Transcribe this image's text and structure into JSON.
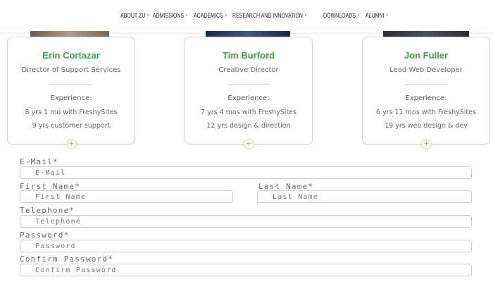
{
  "nav": {
    "items": [
      {
        "label": "ABOUT ZU",
        "chevron": "˅"
      },
      {
        "label": "ADMISSIONS",
        "chevron": "˅"
      },
      {
        "label": "ACADEMICS",
        "chevron": "˅"
      },
      {
        "label": "RESEARCH AND INNOVATION",
        "chevron": "˅"
      },
      {
        "label": "DOWNLOADS",
        "chevron": "˅"
      },
      {
        "label": "ALUMNI",
        "chevron": "˅"
      }
    ]
  },
  "team": [
    {
      "name": "Erin Cortazar",
      "role": "Director of Support Services",
      "exp_label": "Experience:",
      "exp1": "8 yrs 1 mo with FreshySites",
      "exp2": "9 yrs customer support",
      "plus": "+"
    },
    {
      "name": "Tim Burford",
      "role": "Creative Director",
      "exp_label": "Experience:",
      "exp1": "7 yrs 4 mos with FreshySites",
      "exp2": "12 yrs design & direction",
      "plus": "+"
    },
    {
      "name": "Jon Fuller",
      "role": "Lead Web Developer",
      "exp_label": "Experience:",
      "exp1": "6 yrs 11 mos with FreshySites",
      "exp2": "19 yrs web design & dev",
      "plus": "+"
    }
  ],
  "form": {
    "email": {
      "label": "E-Mail*",
      "placeholder": "E-Mail"
    },
    "first_name": {
      "label": "First Name*",
      "placeholder": "First Name"
    },
    "last_name": {
      "label": "Last Name*",
      "placeholder": "Last Name"
    },
    "telephone": {
      "label": "Telephone*",
      "placeholder": "Telephone"
    },
    "password": {
      "label": "Password*",
      "placeholder": "Password"
    },
    "confirm_password": {
      "label": "Confirm Password*",
      "placeholder": "Confirm Password"
    }
  },
  "colors": {
    "accent_green": "#3aa14a",
    "plus_yellow": "#b7c04a"
  }
}
